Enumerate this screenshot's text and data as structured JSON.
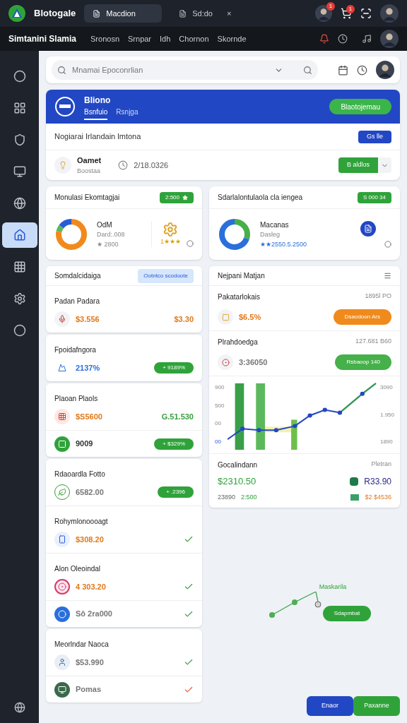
{
  "topbar": {
    "app_name": "Blotogale",
    "tabs": [
      {
        "label": "Macdion",
        "selected": true
      },
      {
        "label": "Sd:do",
        "selected": false
      }
    ],
    "close": "×",
    "badges": [
      "1",
      "1"
    ]
  },
  "navbar": {
    "title": "Simtanini Slamia",
    "links": [
      "Sronosn",
      "Srnpar",
      "Idh",
      "Chornon",
      "Skornde"
    ]
  },
  "sidebar": {
    "items": [
      {
        "selected": false
      },
      {
        "selected": false
      },
      {
        "selected": false
      },
      {
        "selected": false
      },
      {
        "selected": false
      },
      {
        "selected": true
      },
      {
        "selected": false
      },
      {
        "selected": false
      },
      {
        "selected": false
      }
    ]
  },
  "search": {
    "placeholder": "Mnamai Epoconrlian"
  },
  "header_card": {
    "title": "Bliono",
    "tabs": [
      {
        "label": "Bsnfuio",
        "selected": true
      },
      {
        "label": "Rsnjga",
        "selected": false
      }
    ],
    "button": "Blaotojemau",
    "row_label": "Nogiarai Irlandain lmtona",
    "row_button": "Gs lle",
    "item_title": "Oamet",
    "item_subtitle": "Boostaa",
    "item_value": "2/18.0326",
    "split_button": "B aldlos"
  },
  "stat_cards": [
    {
      "title": "Monulasi Ekomtagjai",
      "badge": "2:500",
      "name": "OdM",
      "sub": "Dard:.008",
      "rating": "★ 2800",
      "rating2": "1★★★",
      "segments": [
        {
          "color": "#f08a1c"
        },
        {
          "color": "#5cb85c"
        },
        {
          "color": "#2a5bd7"
        }
      ]
    },
    {
      "title": "Sdarlalontulaola cla iengea",
      "badge": "S 000 34",
      "name": "Macanas",
      "sub": "Dasleg",
      "rating": "★★2550.5.2500",
      "segments": [
        {
          "color": "#46b04a"
        },
        {
          "color": "#2a6fdb"
        }
      ]
    }
  ],
  "list_cards": [
    {
      "title": "Somdalcidaiga",
      "badge": "Ootntco scodoote",
      "sections": [
        {
          "heading": "Padan Padara",
          "rows": [
            {
              "kind": "amount",
              "value": "$3.556",
              "color": "#e07a1a",
              "trailing": {
                "text": "$3.30",
                "color": "#e07a1a"
              }
            }
          ]
        }
      ]
    },
    {
      "sections": [
        {
          "heading": "Fpoidafngora",
          "rows": [
            {
              "kind": "pill",
              "value": "2137%",
              "color": "#2a6fdb",
              "trailing": "+ 9189%"
            }
          ]
        }
      ]
    },
    {
      "sections": [
        {
          "heading": "Plaoan Plaols",
          "rows": [
            {
              "kind": "amount",
              "value": "$S5600",
              "color": "#e07a1a",
              "trailing": {
                "text": "G.51.530",
                "color": "#3aa040"
              }
            },
            {
              "kind": "pill",
              "value": "9009",
              "color": "#333333",
              "trailing": "+ $329%"
            }
          ]
        }
      ]
    },
    {
      "sections": [
        {
          "heading": "Rdaoardla Fotto",
          "rows": [
            {
              "kind": "pill",
              "value": "6582.00",
              "color": "#777777",
              "trailing": "+ .2396"
            }
          ]
        },
        {
          "heading": "Rohymlonoooagt",
          "rows": [
            {
              "kind": "check",
              "value": "$308.20",
              "color": "#e07a1a",
              "check": {
                "color": "#3aa040"
              }
            }
          ]
        },
        {
          "heading": "Alon Oleoindal",
          "rows": [
            {
              "kind": "check",
              "value": "4 303.20",
              "color": "#e07a1a",
              "check": {
                "color": "#3aa040"
              }
            },
            {
              "kind": "check",
              "value": "Sô 2ra000",
              "color": "#777777",
              "check": {
                "color": "#3aa040"
              }
            }
          ]
        }
      ]
    },
    {
      "sections": [
        {
          "heading": "Meorlndar Naoca",
          "rows": [
            {
              "kind": "check",
              "value": "$53.990",
              "color": "#777777",
              "check": {
                "color": "#3aa040"
              }
            },
            {
              "kind": "check",
              "value": "Pomas",
              "color": "#777777",
              "check": {
                "color": "#e0603a"
              }
            }
          ]
        }
      ]
    }
  ],
  "orders": {
    "title": "Nejpani Matjan",
    "rows": [
      {
        "name": "Pakatarlokais",
        "meta": "1895l PO",
        "value": "$6.5%",
        "color": "#e07a1a",
        "button": {
          "label": "Dsaodoon Ars",
          "color": "#f08a1c"
        }
      },
      {
        "name": "Plrahdoedga",
        "meta": "127.681 B60",
        "value": "3:36050",
        "color": "#777777",
        "button": {
          "label": "Rsbaoop 140",
          "color": "#46b04a"
        }
      }
    ],
    "left_ticks": [
      "900",
      "500",
      "00",
      "00"
    ],
    "right_ticks": [
      "3090",
      "1.950",
      "1890"
    ],
    "footer": {
      "label": "Gocalindann",
      "label_right": "Pletran",
      "total": "$2310.50",
      "total_right": "R33.90",
      "sub": "23890",
      "sub_green": "2:500",
      "sub_right": "$2 $4536"
    }
  },
  "diagram": {
    "label": "Maskarila",
    "button": "Sdapmbat"
  },
  "actions": [
    "Enaor",
    "Paxanne"
  ]
}
